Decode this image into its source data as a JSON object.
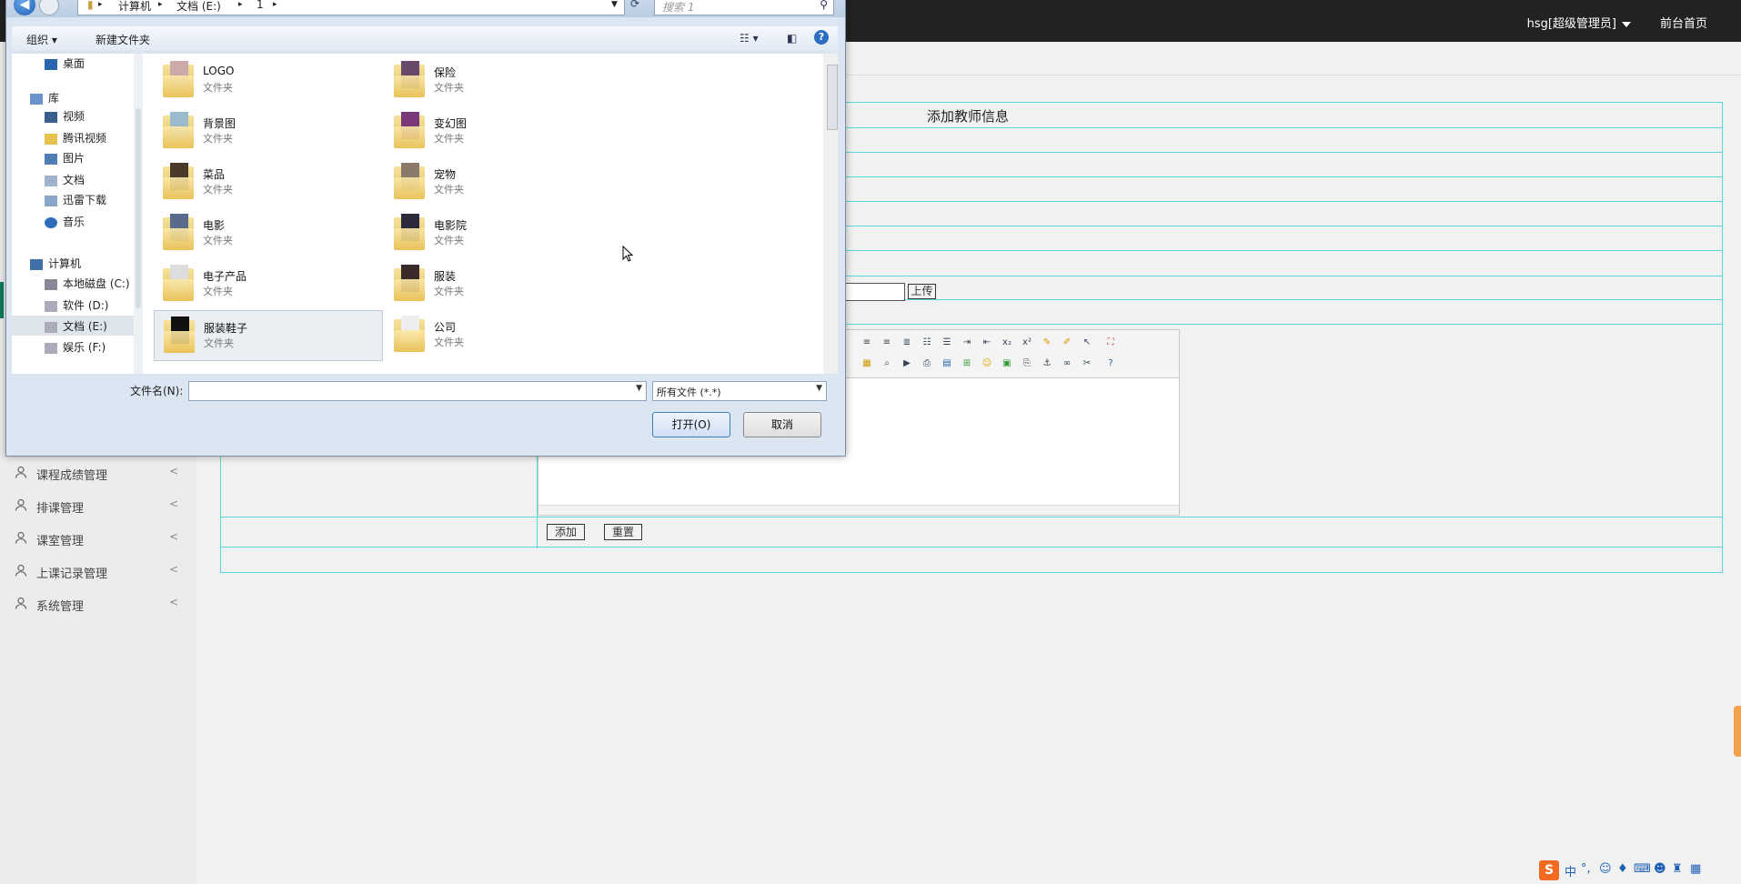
{
  "topbar": {
    "user_label": "hsg[超级管理员]",
    "front_link": "前台首页"
  },
  "sidebar": {
    "items": [
      {
        "label": "课程成绩管理"
      },
      {
        "label": "排课管理"
      },
      {
        "label": "课室管理"
      },
      {
        "label": "上课记录管理"
      },
      {
        "label": "系统管理"
      }
    ]
  },
  "form": {
    "title": "添加教师信息",
    "upload_label": "上传",
    "add_label": "添加",
    "reset_label": "重置"
  },
  "dialog": {
    "breadcrumb": [
      "计算机",
      "文档 (E:)",
      "1"
    ],
    "search_placeholder": "搜索 1",
    "toolbar": {
      "organize": "组织 ▾",
      "new_folder": "新建文件夹"
    },
    "nav": {
      "desktop": "桌面",
      "library": "库",
      "video": "视频",
      "tencent_video": "腾讯视频",
      "pictures": "图片",
      "documents": "文档",
      "xunlei": "迅雷下载",
      "music": "音乐",
      "computer": "计算机",
      "drive_c": "本地磁盘 (C:)",
      "drive_d": "软件 (D:)",
      "drive_e": "文档 (E:)",
      "drive_f": "娱乐 (F:)"
    },
    "folders": [
      {
        "name": "LOGO",
        "type": "文件夹"
      },
      {
        "name": "保险",
        "type": "文件夹"
      },
      {
        "name": "背景图",
        "type": "文件夹"
      },
      {
        "name": "变幻图",
        "type": "文件夹"
      },
      {
        "name": "菜品",
        "type": "文件夹"
      },
      {
        "name": "宠物",
        "type": "文件夹"
      },
      {
        "name": "电影",
        "type": "文件夹"
      },
      {
        "name": "电影院",
        "type": "文件夹"
      },
      {
        "name": "电子产品",
        "type": "文件夹"
      },
      {
        "name": "服装",
        "type": "文件夹"
      },
      {
        "name": "服装鞋子",
        "type": "文件夹"
      },
      {
        "name": "公司",
        "type": "文件夹"
      }
    ],
    "filename_label": "文件名(N):",
    "filename_value": "",
    "filetype": "所有文件 (*.*)",
    "open_label": "打开(O)",
    "cancel_label": "取消"
  },
  "ime": {
    "lang": "中"
  },
  "colors": {
    "topbar": "#222222",
    "table_border": "#5cd6d6",
    "accent": "#1d5fb5"
  }
}
